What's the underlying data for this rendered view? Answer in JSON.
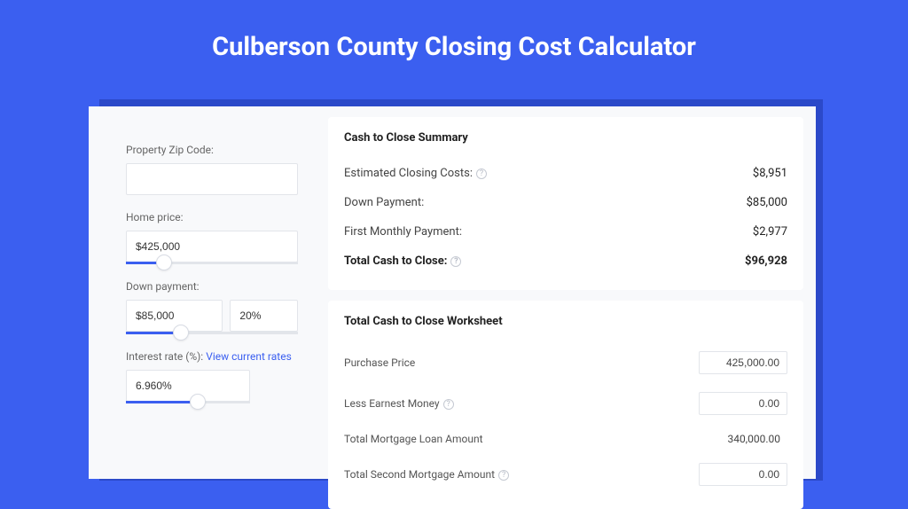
{
  "title": "Culberson County Closing Cost Calculator",
  "form": {
    "zip_label": "Property Zip Code:",
    "zip_value": "",
    "home_price_label": "Home price:",
    "home_price_value": "$425,000",
    "home_price_slider_pct": 22,
    "down_payment_label": "Down payment:",
    "down_payment_value": "$85,000",
    "down_payment_pct_value": "20%",
    "down_payment_slider_pct": 32,
    "interest_label": "Interest rate (%):",
    "interest_link": "View current rates",
    "interest_value": "6.960%",
    "interest_slider_pct": 58
  },
  "summary": {
    "heading": "Cash to Close Summary",
    "rows": [
      {
        "label": "Estimated Closing Costs:",
        "help": true,
        "value": "$8,951",
        "bold": false
      },
      {
        "label": "Down Payment:",
        "help": false,
        "value": "$85,000",
        "bold": false
      },
      {
        "label": "First Monthly Payment:",
        "help": false,
        "value": "$2,977",
        "bold": false
      },
      {
        "label": "Total Cash to Close:",
        "help": true,
        "value": "$96,928",
        "bold": true
      }
    ]
  },
  "worksheet": {
    "heading": "Total Cash to Close Worksheet",
    "rows": [
      {
        "label": "Purchase Price",
        "help": false,
        "editable": true,
        "value": "425,000.00"
      },
      {
        "label": "Less Earnest Money",
        "help": true,
        "editable": true,
        "value": "0.00"
      },
      {
        "label": "Total Mortgage Loan Amount",
        "help": false,
        "editable": false,
        "value": "340,000.00"
      },
      {
        "label": "Total Second Mortgage Amount",
        "help": true,
        "editable": true,
        "value": "0.00"
      }
    ]
  }
}
